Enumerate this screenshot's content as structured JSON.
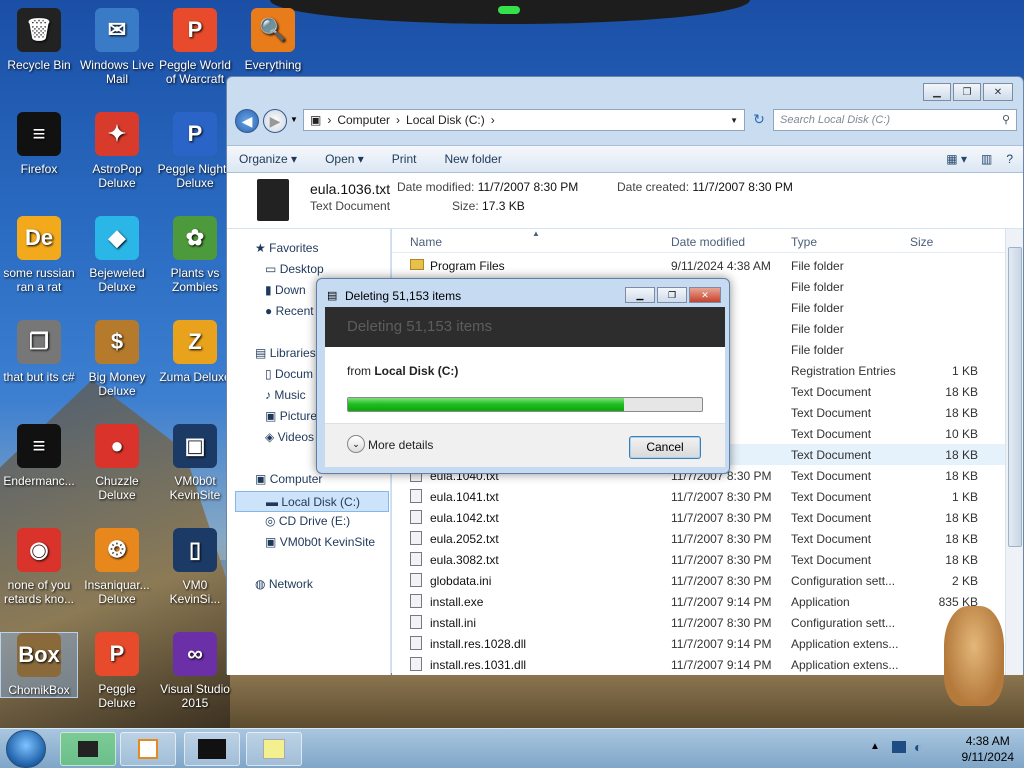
{
  "desktop": {
    "icons": [
      {
        "label": "Recycle Bin",
        "glyph": "🗑"
      },
      {
        "label": "Windows Live Mail",
        "glyph": "✉"
      },
      {
        "label": "Peggle World of Warcraft",
        "glyph": "P"
      },
      {
        "label": "Everything",
        "glyph": "🔍"
      },
      {
        "label": "Firefox",
        "glyph": "≡"
      },
      {
        "label": "AstroPop Deluxe",
        "glyph": "✦"
      },
      {
        "label": "Peggle Nights Deluxe",
        "glyph": "P"
      },
      {
        "label": "some russian ran a rat",
        "glyph": "De"
      },
      {
        "label": "Bejeweled Deluxe",
        "glyph": "◆"
      },
      {
        "label": "Plants vs Zombies",
        "glyph": "✿"
      },
      {
        "label": "that but its c#",
        "glyph": "❐"
      },
      {
        "label": "Big Money Deluxe",
        "glyph": "$"
      },
      {
        "label": "Zuma Deluxe",
        "glyph": "Z"
      },
      {
        "label": "Endermanc...",
        "glyph": "≡"
      },
      {
        "label": "Chuzzle Deluxe",
        "glyph": "●"
      },
      {
        "label": "VM0b0t KevinSite",
        "glyph": "▣"
      },
      {
        "label": "none of you retards kno...",
        "glyph": "◉"
      },
      {
        "label": "Insaniquar... Deluxe",
        "glyph": "❂"
      },
      {
        "label": "VM0 KevinSi...",
        "glyph": "▯"
      },
      {
        "label": "ChomikBox",
        "glyph": "Box"
      },
      {
        "label": "Peggle Deluxe",
        "glyph": "P"
      },
      {
        "label": "Visual Studio 2015",
        "glyph": "∞"
      }
    ]
  },
  "explorer": {
    "address": {
      "crumbs": [
        "Computer",
        "Local Disk (C:)"
      ],
      "search_placeholder": "Search Local Disk (C:)"
    },
    "toolbar": {
      "organize": "Organize ▾",
      "open": "Open ▾",
      "print": "Print",
      "new_folder": "New folder"
    },
    "details": {
      "filename": "eula.1036.txt",
      "type": "Text Document",
      "modified_label": "Date modified:",
      "modified": "11/7/2007 8:30 PM",
      "created_label": "Date created:",
      "created": "11/7/2007 8:30 PM",
      "size_label": "Size:",
      "size": "17.3 KB"
    },
    "nav": {
      "favorites": "Favorites",
      "desktop": "Desktop",
      "downloads": "Down",
      "recent": "Recent",
      "libraries": "Libraries",
      "documents": "Docum",
      "music": "Music",
      "pictures": "Picture",
      "videos": "Videos",
      "computer": "Computer",
      "local_disk": "Local Disk (C:)",
      "cd_drive": "CD Drive (E:)",
      "vm": "VM0b0t KevinSite",
      "network": "Network"
    },
    "columns": {
      "name": "Name",
      "date": "Date modified",
      "type": "Type",
      "size": "Size"
    },
    "rows": [
      {
        "name": "Program Files",
        "date": "9/11/2024 4:38 AM",
        "type": "File folder",
        "size": "",
        "kind": "folder"
      },
      {
        "name": "",
        "date": "35 PM",
        "type": "File folder",
        "size": "",
        "kind": "folder"
      },
      {
        "name": "",
        "date": "35 PM",
        "type": "File folder",
        "size": "",
        "kind": "folder"
      },
      {
        "name": "",
        "date": "22 PM",
        "type": "File folder",
        "size": "",
        "kind": "folder"
      },
      {
        "name": "",
        "date": "34 AM",
        "type": "File folder",
        "size": "",
        "kind": "folder"
      },
      {
        "name": "",
        "date": "08 AM",
        "type": "Registration Entries",
        "size": "1 KB",
        "kind": "file"
      },
      {
        "name": "",
        "date": "30 PM",
        "type": "Text Document",
        "size": "18 KB",
        "kind": "file"
      },
      {
        "name": "",
        "date": "30 PM",
        "type": "Text Document",
        "size": "18 KB",
        "kind": "file"
      },
      {
        "name": "",
        "date": "30 PM",
        "type": "Text Document",
        "size": "10 KB",
        "kind": "file"
      },
      {
        "name": "",
        "date": "30 PM",
        "type": "Text Document",
        "size": "18 KB",
        "kind": "file"
      },
      {
        "name": "eula.1040.txt",
        "date": "11/7/2007 8:30 PM",
        "type": "Text Document",
        "size": "18 KB",
        "kind": "file"
      },
      {
        "name": "eula.1041.txt",
        "date": "11/7/2007 8:30 PM",
        "type": "Text Document",
        "size": "1 KB",
        "kind": "file"
      },
      {
        "name": "eula.1042.txt",
        "date": "11/7/2007 8:30 PM",
        "type": "Text Document",
        "size": "18 KB",
        "kind": "file"
      },
      {
        "name": "eula.2052.txt",
        "date": "11/7/2007 8:30 PM",
        "type": "Text Document",
        "size": "18 KB",
        "kind": "file"
      },
      {
        "name": "eula.3082.txt",
        "date": "11/7/2007 8:30 PM",
        "type": "Text Document",
        "size": "18 KB",
        "kind": "file"
      },
      {
        "name": "globdata.ini",
        "date": "11/7/2007 8:30 PM",
        "type": "Configuration sett...",
        "size": "2 KB",
        "kind": "file"
      },
      {
        "name": "install.exe",
        "date": "11/7/2007 9:14 PM",
        "type": "Application",
        "size": "835 KB",
        "kind": "file"
      },
      {
        "name": "install.ini",
        "date": "11/7/2007 8:30 PM",
        "type": "Configuration sett...",
        "size": "",
        "kind": "file"
      },
      {
        "name": "install.res.1028.dll",
        "date": "11/7/2007 9:14 PM",
        "type": "Application extens...",
        "size": "",
        "kind": "file"
      },
      {
        "name": "install.res.1031.dll",
        "date": "11/7/2007 9:14 PM",
        "type": "Application extens...",
        "size": "",
        "kind": "file"
      }
    ]
  },
  "dialog": {
    "title": "Deleting 51,153 items",
    "band": "Deleting 51,153 items",
    "from_prefix": "from",
    "from_target": "Local Disk (C:)",
    "progress": 0.78,
    "more_details": "More details",
    "cancel": "Cancel"
  },
  "taskbar": {
    "time": "4:38 AM",
    "date": "9/11/2024"
  }
}
